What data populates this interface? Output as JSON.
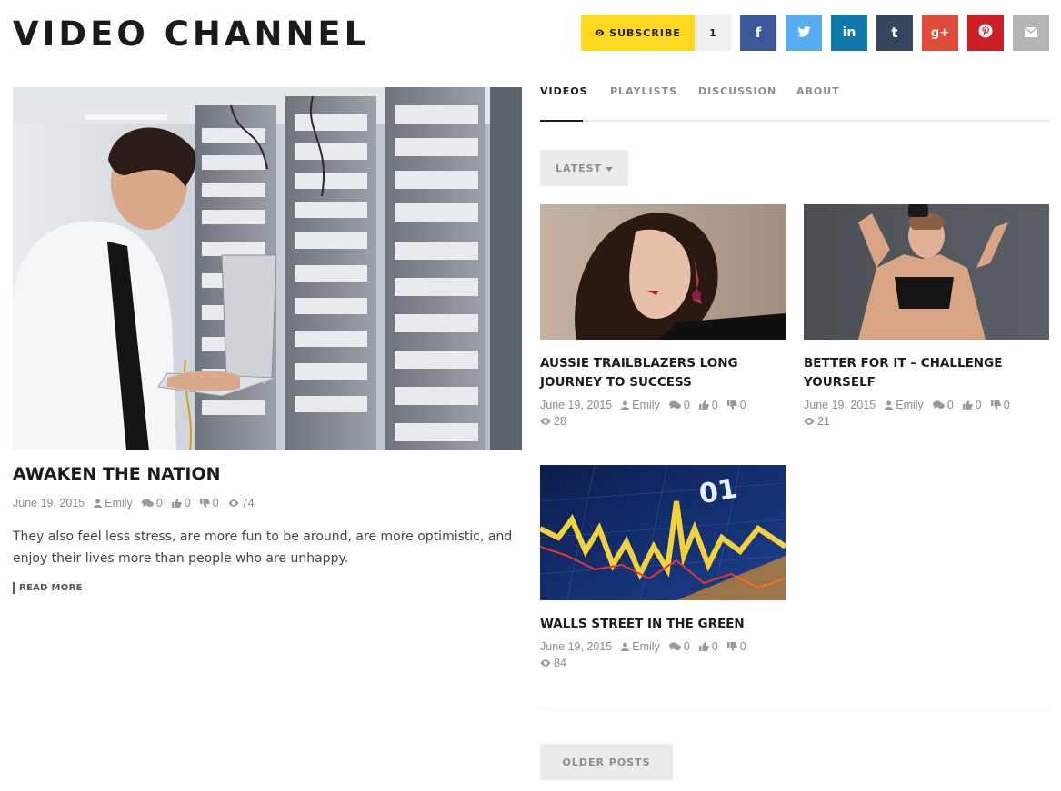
{
  "header": {
    "title": "VIDEO CHANNEL",
    "subscribe_label": "SUBSCRIBE",
    "subscribe_count": "1",
    "social": [
      {
        "name": "facebook",
        "glyph": "f",
        "color": "#3b5998"
      },
      {
        "name": "twitter",
        "glyph": "t",
        "color": "#55acee"
      },
      {
        "name": "linkedin",
        "glyph": "in",
        "color": "#0e76a8"
      },
      {
        "name": "tumblr",
        "glyph": "t",
        "color": "#35465c"
      },
      {
        "name": "google-plus",
        "glyph": "g+",
        "color": "#dd4b39"
      },
      {
        "name": "pinterest",
        "glyph": "p",
        "color": "#cb2027"
      },
      {
        "name": "email",
        "glyph": "",
        "color": "#b5b5b5"
      }
    ]
  },
  "featured": {
    "title": "AWAKEN THE NATION",
    "date": "June 19, 2015",
    "author": "Emily",
    "comments": "0",
    "likes": "0",
    "dislikes": "0",
    "views": "74",
    "excerpt": "They also feel less stress, are more fun to be around, are more optimistic, and enjoy their lives more than people who are unhappy.",
    "read_more": "READ MORE",
    "image": "man with laptop in server room"
  },
  "tabs": [
    "VIDEOS",
    "PLAYLISTS",
    "DISCUSSION",
    "ABOUT"
  ],
  "active_tab": "VIDEOS",
  "sort": {
    "label": "LATEST"
  },
  "videos": [
    {
      "title": "AUSSIE TRAILBLAZERS LONG JOURNEY TO SUCCESS",
      "date": "June 19, 2015",
      "author": "Emily",
      "comments": "0",
      "likes": "0",
      "dislikes": "0",
      "views": "28",
      "image": "woman with earring"
    },
    {
      "title": "BETTER FOR IT – CHALLENGE YOURSELF",
      "date": "June 19, 2015",
      "author": "Emily",
      "comments": "0",
      "likes": "0",
      "dislikes": "0",
      "views": "21",
      "image": "fitness woman"
    },
    {
      "title": "WALLS STREET IN THE GREEN",
      "date": "June 19, 2015",
      "author": "Emily",
      "comments": "0",
      "likes": "0",
      "dislikes": "0",
      "views": "84",
      "image": "stock market chart"
    }
  ],
  "pagination": {
    "older_label": "OLDER POSTS"
  }
}
